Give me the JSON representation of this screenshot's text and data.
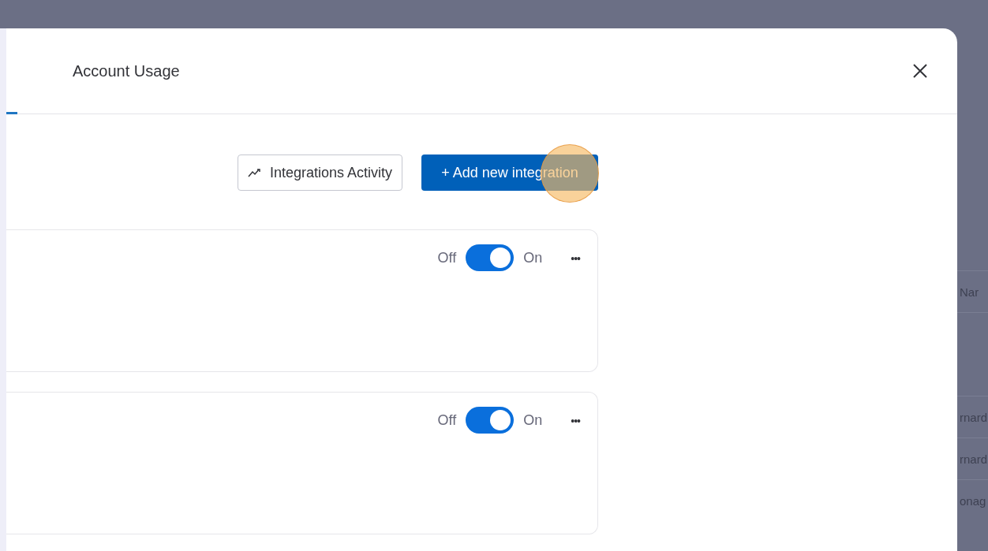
{
  "modal": {
    "tabs": [
      {
        "label": "Account Usage",
        "selected": false
      }
    ],
    "toolbar": {
      "activity_button": "Integrations Activity",
      "add_button": "+ Add new integration"
    },
    "integrations": [
      {
        "off_label": "Off",
        "on_label": "On",
        "on": true,
        "menu": "•••"
      },
      {
        "off_label": "Off",
        "on_label": "On",
        "on": true,
        "menu": "•••"
      }
    ]
  },
  "background_table": {
    "header": "Nar",
    "rows": [
      "rnard",
      "rnard",
      "onag"
    ]
  }
}
